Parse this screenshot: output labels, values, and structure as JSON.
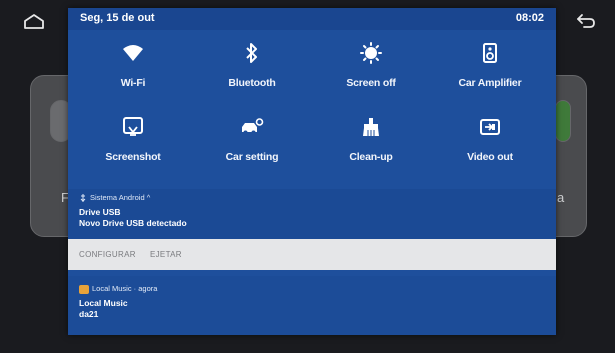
{
  "status_bar": {
    "date": "Seg, 15 de out",
    "time": "08:02"
  },
  "system_buttons": {
    "home_icon": "home-icon",
    "back_icon": "back-arrow-icon"
  },
  "quick_settings": [
    {
      "label": "Wi-Fi",
      "icon": "wifi-icon"
    },
    {
      "label": "Bluetooth",
      "icon": "bluetooth-icon"
    },
    {
      "label": "Screen off",
      "icon": "screen-off-icon"
    },
    {
      "label": "Car Amplifier",
      "icon": "speaker-icon"
    },
    {
      "label": "Screenshot",
      "icon": "screenshot-icon"
    },
    {
      "label": "Car setting",
      "icon": "car-settings-icon"
    },
    {
      "label": "Clean-up",
      "icon": "broom-icon"
    },
    {
      "label": "Video out",
      "icon": "video-out-icon"
    }
  ],
  "notifications": [
    {
      "header": "Sistema Android",
      "header_suffix": "^",
      "title": "Drive USB",
      "text": "Novo Drive USB detectado",
      "actions": [
        "CONFIGURAR",
        "EJETAR"
      ]
    },
    {
      "header": "Local Music · agora",
      "title": "Local Music",
      "text": "da21"
    }
  ],
  "background": {
    "left_letter": "F",
    "right_letter": "a"
  },
  "colors": {
    "shade": "#1e4f9c",
    "action_bar": "#e5e6e8",
    "background": "#0b0b0d"
  }
}
